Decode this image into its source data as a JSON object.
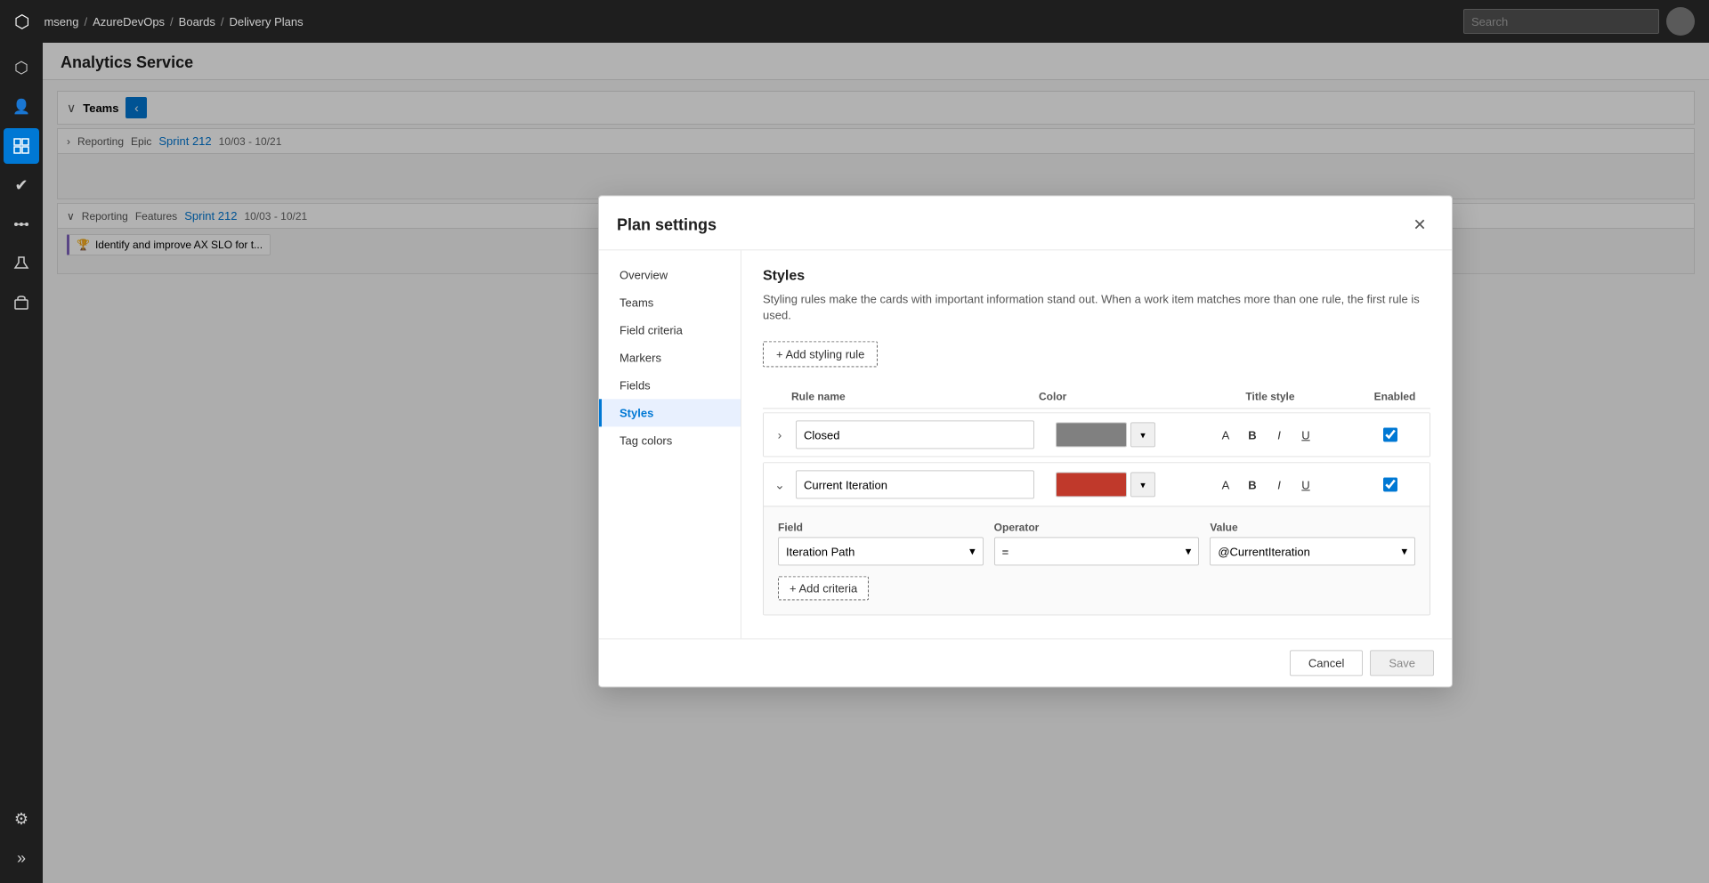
{
  "topnav": {
    "logo": "⬡",
    "breadcrumb": [
      {
        "label": "mseng",
        "sep": "/"
      },
      {
        "label": "AzureDevOps",
        "sep": "/"
      },
      {
        "label": "Boards",
        "sep": "/"
      },
      {
        "label": "Delivery Plans",
        "sep": ""
      }
    ],
    "search_placeholder": "Search"
  },
  "sidebar": {
    "items": [
      {
        "icon": "⬡",
        "label": "home-icon",
        "active": false
      },
      {
        "icon": "👤",
        "label": "profile-icon",
        "active": false
      },
      {
        "icon": "📋",
        "label": "boards-icon",
        "active": true
      },
      {
        "icon": "✔",
        "label": "work-items-icon",
        "active": false
      },
      {
        "icon": "⚡",
        "label": "pipelines-icon",
        "active": false
      },
      {
        "icon": "🧪",
        "label": "test-plans-icon",
        "active": false
      },
      {
        "icon": "🔧",
        "label": "artifacts-icon",
        "active": false
      }
    ],
    "bottom_items": [
      {
        "icon": "⚙",
        "label": "settings-icon"
      },
      {
        "icon": "»",
        "label": "expand-icon"
      }
    ]
  },
  "page": {
    "title": "Analytics Service"
  },
  "board": {
    "teams_label": "Teams",
    "collapse_icon": "‹",
    "rows": [
      {
        "group": "Reporting",
        "type": "Epic",
        "sprint_name": "Sprint 212",
        "sprint_date": "10/03 - 10/21",
        "work_items": []
      },
      {
        "group": "Reporting",
        "type": "Features",
        "sprint_name": "Sprint 212",
        "sprint_date": "10/03 - 10/21",
        "work_items": [
          {
            "label": "Identify and improve AX SLO for t..."
          }
        ]
      }
    ]
  },
  "dialog": {
    "title": "Plan settings",
    "close_label": "✕",
    "nav_items": [
      {
        "label": "Overview",
        "active": false
      },
      {
        "label": "Teams",
        "active": false
      },
      {
        "label": "Field criteria",
        "active": false
      },
      {
        "label": "Markers",
        "active": false
      },
      {
        "label": "Fields",
        "active": false
      },
      {
        "label": "Styles",
        "active": true
      },
      {
        "label": "Tag colors",
        "active": false
      }
    ],
    "styles": {
      "section_title": "Styles",
      "section_desc": "Styling rules make the cards with important information stand out. When a work item matches more than one rule, the first rule is used.",
      "add_rule_label": "+ Add styling rule",
      "columns": {
        "rule_name": "Rule name",
        "color": "Color",
        "title_style": "Title style",
        "enabled": "Enabled"
      },
      "rules": [
        {
          "id": "rule-closed",
          "expanded": false,
          "name": "Closed",
          "color": "#808080",
          "enabled": true,
          "expand_icon": "›"
        },
        {
          "id": "rule-current-iteration",
          "expanded": true,
          "name": "Current Iteration",
          "color": "#c0392b",
          "enabled": true,
          "expand_icon": "⌄",
          "criteria": [
            {
              "field_label": "Field",
              "field_value": "Iteration Path",
              "operator_label": "Operator",
              "operator_value": "=",
              "value_label": "Value",
              "value_value": "@CurrentIteration"
            }
          ],
          "add_criteria_label": "+ Add criteria"
        }
      ],
      "footer": {
        "cancel_label": "Cancel",
        "save_label": "Save"
      }
    }
  }
}
